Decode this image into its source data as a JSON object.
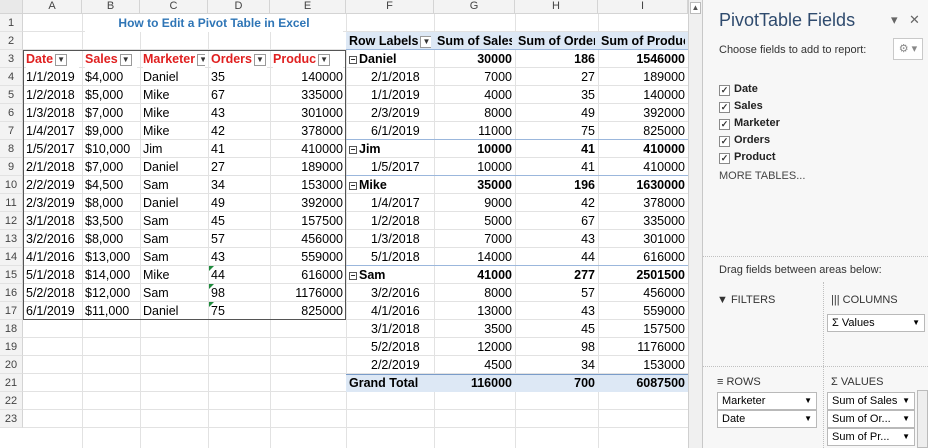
{
  "columns": [
    "A",
    "B",
    "C",
    "D",
    "E",
    "F",
    "G",
    "H",
    "I"
  ],
  "rows": [
    "1",
    "2",
    "3",
    "4",
    "5",
    "6",
    "7",
    "8",
    "9",
    "10",
    "11",
    "12",
    "13",
    "14",
    "15",
    "16",
    "17",
    "18",
    "19",
    "20",
    "21",
    "22",
    "23"
  ],
  "sheet_title": "How to Edit a Pivot Table in Excel",
  "source_table": {
    "headers": [
      "Date",
      "Sales",
      "Marketer",
      "Orders",
      "Produc"
    ],
    "rows": [
      [
        "1/1/2019",
        "$4,000",
        "Daniel",
        "35",
        "140000"
      ],
      [
        "1/2/2018",
        "$5,000",
        "Mike",
        "67",
        "335000"
      ],
      [
        "1/3/2018",
        "$7,000",
        "Mike",
        "43",
        "301000"
      ],
      [
        "1/4/2017",
        "$9,000",
        "Mike",
        "42",
        "378000"
      ],
      [
        "1/5/2017",
        "$10,000",
        "Jim",
        "41",
        "410000"
      ],
      [
        "2/1/2018",
        "$7,000",
        "Daniel",
        "27",
        "189000"
      ],
      [
        "2/2/2019",
        "$4,500",
        "Sam",
        "34",
        "153000"
      ],
      [
        "2/3/2019",
        "$8,000",
        "Daniel",
        "49",
        "392000"
      ],
      [
        "3/1/2018",
        "$3,500",
        "Sam",
        "45",
        "157500"
      ],
      [
        "3/2/2016",
        "$8,000",
        "Sam",
        "57",
        "456000"
      ],
      [
        "4/1/2016",
        "$13,000",
        "Sam",
        "43",
        "559000"
      ],
      [
        "5/1/2018",
        "$14,000",
        "Mike",
        "44",
        "616000"
      ],
      [
        "5/2/2018",
        "$12,000",
        "Sam",
        "98",
        "1176000"
      ],
      [
        "6/1/2019",
        "$11,000",
        "Daniel",
        "75",
        "825000"
      ]
    ]
  },
  "pivot": {
    "headers": [
      "Row Labels",
      "Sum of Sales",
      "Sum of Orders",
      "Sum of Product"
    ],
    "rows": [
      {
        "label": "Daniel",
        "sales": "30000",
        "orders": "186",
        "product": "1546000",
        "group": true
      },
      {
        "label": "2/1/2018",
        "sales": "7000",
        "orders": "27",
        "product": "189000"
      },
      {
        "label": "1/1/2019",
        "sales": "4000",
        "orders": "35",
        "product": "140000"
      },
      {
        "label": "2/3/2019",
        "sales": "8000",
        "orders": "49",
        "product": "392000"
      },
      {
        "label": "6/1/2019",
        "sales": "11000",
        "orders": "75",
        "product": "825000"
      },
      {
        "label": "Jim",
        "sales": "10000",
        "orders": "41",
        "product": "410000",
        "group": true
      },
      {
        "label": "1/5/2017",
        "sales": "10000",
        "orders": "41",
        "product": "410000"
      },
      {
        "label": "Mike",
        "sales": "35000",
        "orders": "196",
        "product": "1630000",
        "group": true
      },
      {
        "label": "1/4/2017",
        "sales": "9000",
        "orders": "42",
        "product": "378000"
      },
      {
        "label": "1/2/2018",
        "sales": "5000",
        "orders": "67",
        "product": "335000"
      },
      {
        "label": "1/3/2018",
        "sales": "7000",
        "orders": "43",
        "product": "301000"
      },
      {
        "label": "5/1/2018",
        "sales": "14000",
        "orders": "44",
        "product": "616000"
      },
      {
        "label": "Sam",
        "sales": "41000",
        "orders": "277",
        "product": "2501500",
        "group": true
      },
      {
        "label": "3/2/2016",
        "sales": "8000",
        "orders": "57",
        "product": "456000"
      },
      {
        "label": "4/1/2016",
        "sales": "13000",
        "orders": "43",
        "product": "559000"
      },
      {
        "label": "3/1/2018",
        "sales": "3500",
        "orders": "45",
        "product": "157500"
      },
      {
        "label": "5/2/2018",
        "sales": "12000",
        "orders": "98",
        "product": "1176000"
      },
      {
        "label": "2/2/2019",
        "sales": "4500",
        "orders": "34",
        "product": "153000"
      }
    ],
    "grand": {
      "label": "Grand Total",
      "sales": "116000",
      "orders": "700",
      "product": "6087500"
    }
  },
  "panel": {
    "title": "PivotTable Fields",
    "choose": "Choose fields to add to report:",
    "fields": [
      "Date",
      "Sales",
      "Marketer",
      "Orders",
      "Product"
    ],
    "more_tables": "MORE TABLES...",
    "drag_label": "Drag fields between areas below:",
    "filters": "FILTERS",
    "columns": "COLUMNS",
    "columns_item": "Σ Values",
    "rows_label": "ROWS",
    "values_label": "VALUES",
    "rows_items": [
      "Marketer",
      "Date"
    ],
    "values_items": [
      "Sum of Sales",
      "Sum of Or...",
      "Sum of Pr..."
    ]
  },
  "colors": {
    "title_blue": "#2e75b6",
    "header_red": "#e02020",
    "pivot_band": "#dde8f5"
  }
}
